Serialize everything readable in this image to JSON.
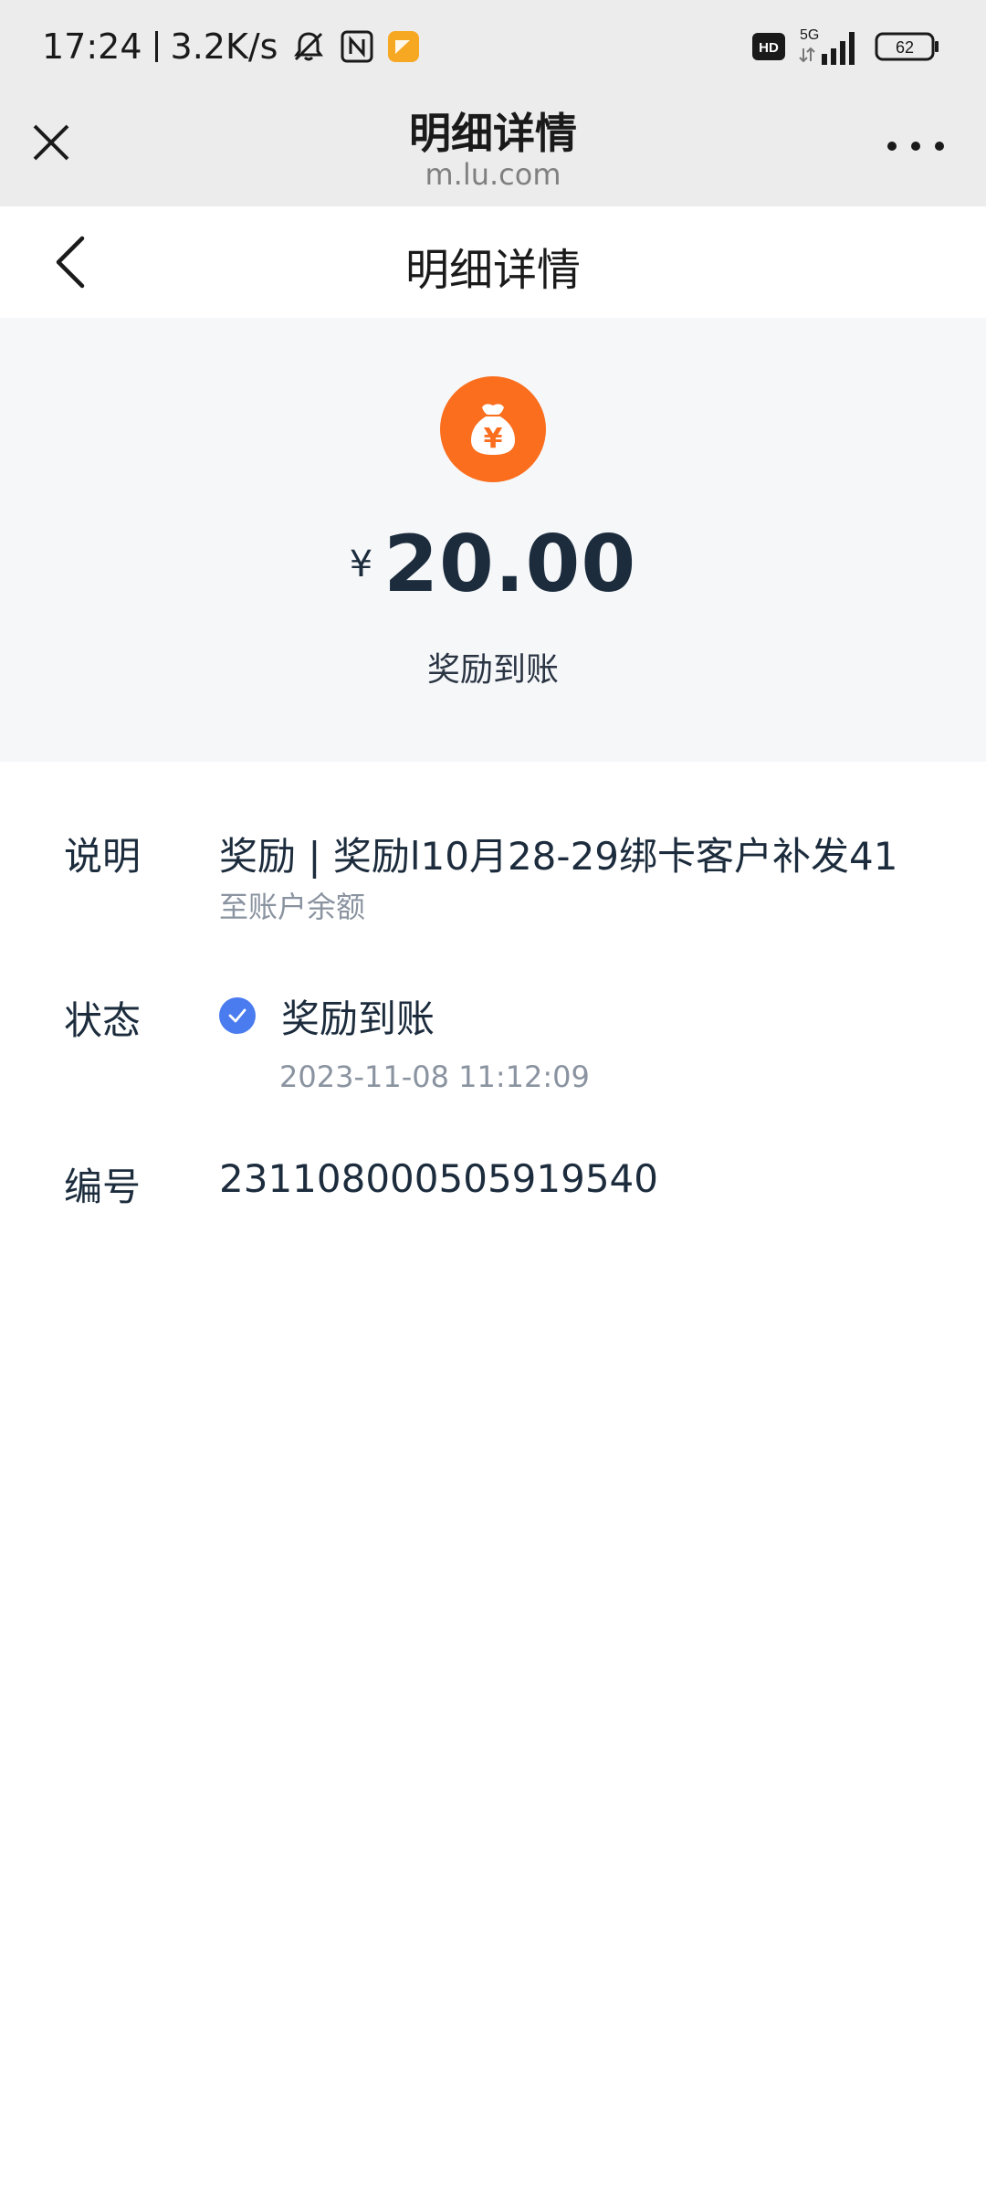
{
  "status_bar": {
    "time": "17:24",
    "speed": "3.2K/s",
    "network": "5G",
    "hd_badge": "HD",
    "battery": "62",
    "icons": [
      "bell-off-icon",
      "nfc-icon",
      "app-notification-icon",
      "hd-icon",
      "signal-icon",
      "battery-icon"
    ]
  },
  "browser": {
    "title": "明细详情",
    "url": "m.lu.com",
    "close_icon": "close-icon",
    "more_icon": "more-icon"
  },
  "page": {
    "title": "明细详情",
    "back_icon": "back-chevron-icon"
  },
  "hero": {
    "icon": "money-bag-icon",
    "icon_symbol": "¥",
    "currency": "¥",
    "amount": "20.00",
    "status": "奖励到账",
    "accent_color": "#fa6e1e"
  },
  "details": {
    "description": {
      "label": "说明",
      "value": "奖励 | 奖励l10月28-29绑卡客户补发41",
      "sub": "至账户余额"
    },
    "status": {
      "label": "状态",
      "value": "奖励到账",
      "time": "2023-11-08 11:12:09",
      "check_color": "#4a7cf0"
    },
    "number": {
      "label": "编号",
      "value": "231108000505919540"
    }
  }
}
